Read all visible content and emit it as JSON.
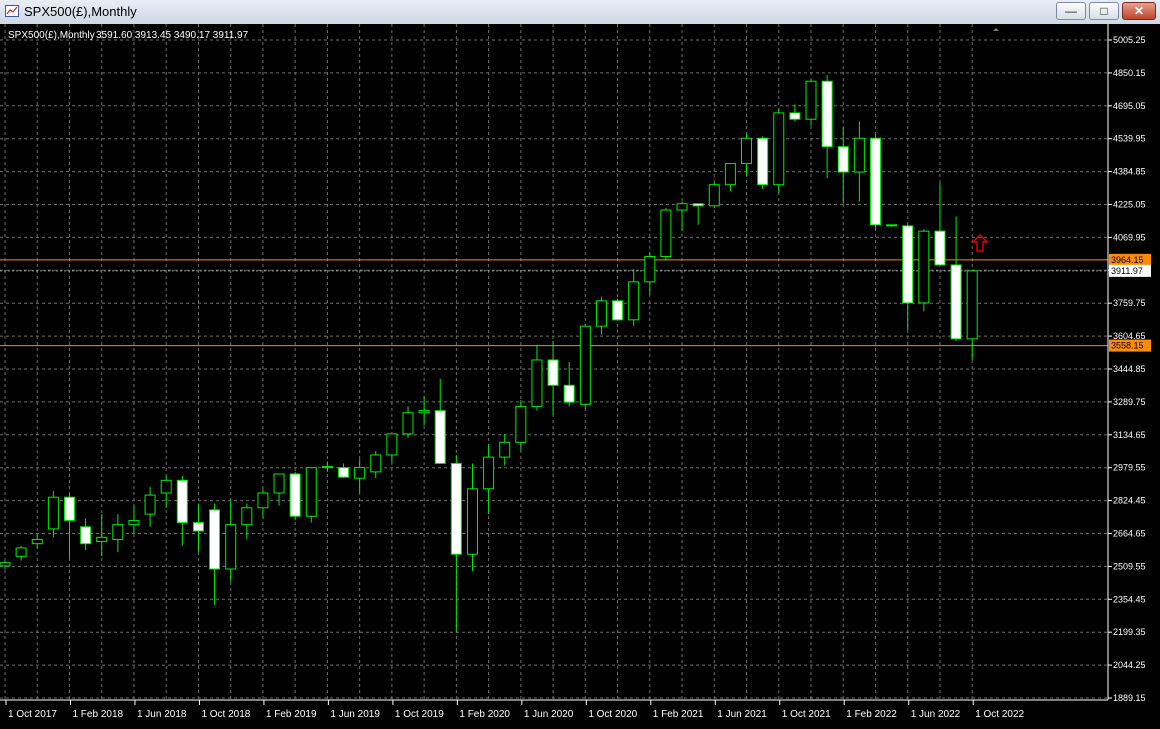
{
  "window": {
    "title": "SPX500(£),Monthly"
  },
  "buttons": {
    "minimize": "—",
    "maximize": "□",
    "close": "✕"
  },
  "icons": {
    "app": "chart-window-icon",
    "arrow": "up-arrow-icon"
  },
  "colors": {
    "background": "#000000",
    "grid": "#6f6f6f",
    "bull": "#000000",
    "bear": "#ffffff",
    "wick": "#00ee00",
    "level": "#ff8c00",
    "arrow": "#dd0000",
    "axis": "#ffffff"
  },
  "chart_data": {
    "type": "candlestick",
    "title": "SPX500(£),Monthly",
    "ohlc_info": "3591.60 3913.45 3490.17 3911.97",
    "y_ticks": [
      "5005.25",
      "4850.15",
      "4695.05",
      "4539.95",
      "4384.85",
      "4225.05",
      "4069.95",
      "3911.97",
      "3759.75",
      "3604.65",
      "3444.85",
      "3289.75",
      "3134.65",
      "2979.55",
      "2824.45",
      "2664.65",
      "2509.55",
      "2354.45",
      "2199.35",
      "2044.25",
      "1889.15"
    ],
    "x_labels": [
      "1 Oct 2017",
      "1 Feb 2018",
      "1 Jun 2018",
      "1 Oct 2018",
      "1 Feb 2019",
      "1 Jun 2019",
      "1 Oct 2019",
      "1 Feb 2020",
      "1 Jun 2020",
      "1 Oct 2020",
      "1 Feb 2021",
      "1 Jun 2021",
      "1 Oct 2021",
      "1 Feb 2022",
      "1 Jun 2022",
      "1 Oct 2022"
    ],
    "ylim": [
      1889.15,
      5005.25
    ],
    "levels": [
      {
        "value": 3964.15,
        "label": "3964.15"
      },
      {
        "value": 3558.15,
        "label": "3558.15"
      }
    ],
    "current_price": {
      "value": 3911.97,
      "label": "3911.97"
    },
    "grid": true,
    "candles": [
      {
        "o": 2515,
        "h": 2540,
        "l": 2500,
        "c": 2530
      },
      {
        "o": 2560,
        "h": 2610,
        "l": 2540,
        "c": 2600
      },
      {
        "o": 2620,
        "h": 2665,
        "l": 2600,
        "c": 2640
      },
      {
        "o": 2690,
        "h": 2870,
        "l": 2650,
        "c": 2840
      },
      {
        "o": 2840,
        "h": 2860,
        "l": 2550,
        "c": 2730
      },
      {
        "o": 2700,
        "h": 2740,
        "l": 2590,
        "c": 2620
      },
      {
        "o": 2630,
        "h": 2760,
        "l": 2560,
        "c": 2650
      },
      {
        "o": 2640,
        "h": 2760,
        "l": 2580,
        "c": 2710
      },
      {
        "o": 2710,
        "h": 2800,
        "l": 2670,
        "c": 2730
      },
      {
        "o": 2760,
        "h": 2890,
        "l": 2700,
        "c": 2850
      },
      {
        "o": 2860,
        "h": 2940,
        "l": 2790,
        "c": 2920
      },
      {
        "o": 2920,
        "h": 2940,
        "l": 2610,
        "c": 2720
      },
      {
        "o": 2720,
        "h": 2810,
        "l": 2580,
        "c": 2680
      },
      {
        "o": 2780,
        "h": 2810,
        "l": 2330,
        "c": 2500
      },
      {
        "o": 2500,
        "h": 2830,
        "l": 2440,
        "c": 2710
      },
      {
        "o": 2710,
        "h": 2810,
        "l": 2640,
        "c": 2790
      },
      {
        "o": 2790,
        "h": 2880,
        "l": 2740,
        "c": 2860
      },
      {
        "o": 2860,
        "h": 2950,
        "l": 2800,
        "c": 2950
      },
      {
        "o": 2950,
        "h": 2960,
        "l": 2730,
        "c": 2750
      },
      {
        "o": 2750,
        "h": 2980,
        "l": 2720,
        "c": 2980
      },
      {
        "o": 2980,
        "h": 3010,
        "l": 2960,
        "c": 2985
      },
      {
        "o": 2980,
        "h": 3000,
        "l": 2930,
        "c": 2935
      },
      {
        "o": 2930,
        "h": 3020,
        "l": 2860,
        "c": 2980
      },
      {
        "o": 2960,
        "h": 3060,
        "l": 2930,
        "c": 3040
      },
      {
        "o": 3040,
        "h": 3140,
        "l": 3000,
        "c": 3140
      },
      {
        "o": 3140,
        "h": 3270,
        "l": 3120,
        "c": 3240
      },
      {
        "o": 3240,
        "h": 3320,
        "l": 3180,
        "c": 3250
      },
      {
        "o": 3250,
        "h": 3400,
        "l": 3130,
        "c": 3000
      },
      {
        "o": 3000,
        "h": 3040,
        "l": 2200,
        "c": 2570
      },
      {
        "o": 2570,
        "h": 3000,
        "l": 2490,
        "c": 2880
      },
      {
        "o": 2880,
        "h": 3090,
        "l": 2760,
        "c": 3030
      },
      {
        "o": 3030,
        "h": 3140,
        "l": 2990,
        "c": 3100
      },
      {
        "o": 3100,
        "h": 3300,
        "l": 3060,
        "c": 3270
      },
      {
        "o": 3270,
        "h": 3560,
        "l": 3250,
        "c": 3490
      },
      {
        "o": 3490,
        "h": 3580,
        "l": 3230,
        "c": 3370
      },
      {
        "o": 3370,
        "h": 3480,
        "l": 3270,
        "c": 3290
      },
      {
        "o": 3280,
        "h": 3660,
        "l": 3260,
        "c": 3650
      },
      {
        "o": 3650,
        "h": 3790,
        "l": 3610,
        "c": 3770
      },
      {
        "o": 3770,
        "h": 3780,
        "l": 3690,
        "c": 3680
      },
      {
        "o": 3680,
        "h": 3920,
        "l": 3650,
        "c": 3860
      },
      {
        "o": 3860,
        "h": 4000,
        "l": 3800,
        "c": 3980
      },
      {
        "o": 3980,
        "h": 4210,
        "l": 3960,
        "c": 4200
      },
      {
        "o": 4200,
        "h": 4240,
        "l": 4100,
        "c": 4230
      },
      {
        "o": 4230,
        "h": 4230,
        "l": 4130,
        "c": 4220
      },
      {
        "o": 4220,
        "h": 4330,
        "l": 4210,
        "c": 4320
      },
      {
        "o": 4320,
        "h": 4420,
        "l": 4290,
        "c": 4420
      },
      {
        "o": 4420,
        "h": 4560,
        "l": 4360,
        "c": 4540
      },
      {
        "o": 4540,
        "h": 4550,
        "l": 4300,
        "c": 4320
      },
      {
        "o": 4320,
        "h": 4680,
        "l": 4280,
        "c": 4660
      },
      {
        "o": 4660,
        "h": 4700,
        "l": 4620,
        "c": 4630
      },
      {
        "o": 4630,
        "h": 4820,
        "l": 4600,
        "c": 4810
      },
      {
        "o": 4810,
        "h": 4840,
        "l": 4350,
        "c": 4500
      },
      {
        "o": 4500,
        "h": 4590,
        "l": 4230,
        "c": 4380
      },
      {
        "o": 4380,
        "h": 4620,
        "l": 4240,
        "c": 4540
      },
      {
        "o": 4540,
        "h": 4560,
        "l": 4110,
        "c": 4130
      },
      {
        "o": 4130,
        "h": 4130,
        "l": 4120,
        "c": 4125
      },
      {
        "o": 4125,
        "h": 4130,
        "l": 3630,
        "c": 3760
      },
      {
        "o": 3760,
        "h": 4110,
        "l": 3720,
        "c": 4100
      },
      {
        "o": 4100,
        "h": 4330,
        "l": 3950,
        "c": 3940
      },
      {
        "o": 3940,
        "h": 4170,
        "l": 3580,
        "c": 3590
      },
      {
        "o": 3590,
        "h": 3913,
        "l": 3490,
        "c": 3912
      }
    ]
  }
}
